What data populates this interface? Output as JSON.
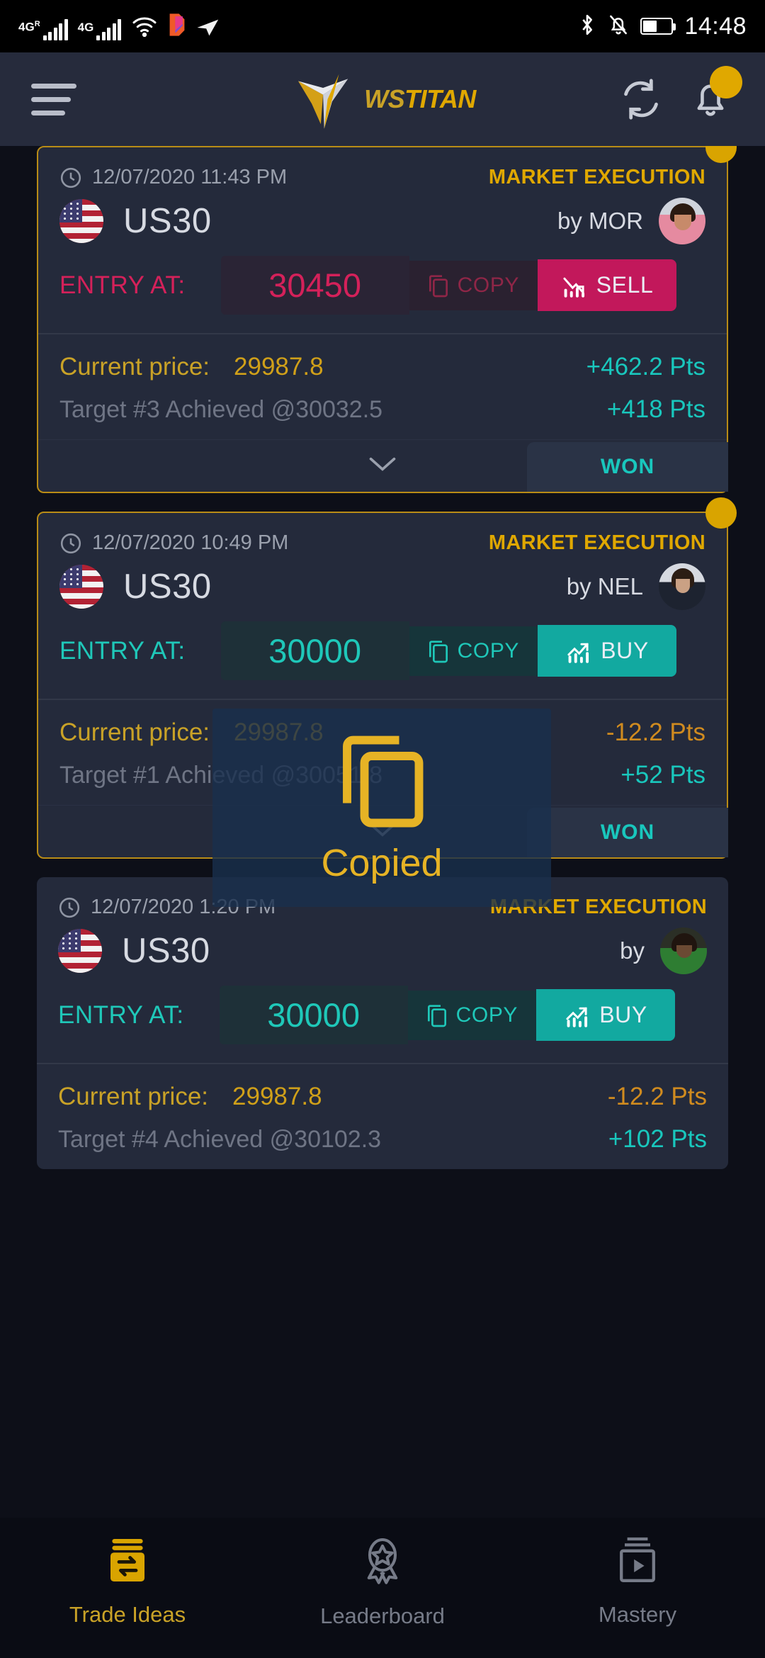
{
  "status_bar": {
    "network_1": "4G",
    "network_1_sup": "R",
    "network_2": "4G",
    "icons": [
      "wifi-icon",
      "app-icon",
      "vpn-icon",
      "bluetooth-icon",
      "silent-bell-icon",
      "battery-icon"
    ],
    "battery_percent": 50,
    "time": "14:48"
  },
  "header": {
    "menu": "menu-icon",
    "brand_ws": "WS",
    "brand_titan": "TITAN",
    "refresh": "refresh-icon",
    "notifications": "bell-icon"
  },
  "cards": [
    {
      "timestamp": "12/07/2020 11:43 PM",
      "execution": "MARKET EXECUTION",
      "symbol": "US30",
      "flag": "us-flag-icon",
      "author_prefix": "by",
      "author": "MOR",
      "entry_label": "ENTRY AT:",
      "entry_value": "30450",
      "copy_label": "COPY",
      "side_label": "SELL",
      "side": "sell",
      "price_label": "Current price:",
      "price_value": "29987.8",
      "price_points": "+462.2 Pts",
      "price_points_sign": "pos",
      "target_label": "Target #3 Achieved @30032.5",
      "target_points": "+418 Pts",
      "status": "WON",
      "has_badge": true
    },
    {
      "timestamp": "12/07/2020 10:49 PM",
      "execution": "MARKET EXECUTION",
      "symbol": "US30",
      "flag": "us-flag-icon",
      "author_prefix": "by",
      "author": "NEL",
      "entry_label": "ENTRY AT:",
      "entry_value": "30000",
      "copy_label": "COPY",
      "side_label": "BUY",
      "side": "buy",
      "price_label": "Current price:",
      "price_value": "29987.8",
      "price_points": "-12.2 Pts",
      "price_points_sign": "neg",
      "target_label": "Target #1 Achieved @30051.8",
      "target_points": "+52 Pts",
      "status": "WON",
      "has_badge": true
    },
    {
      "timestamp": "12/07/2020 1:20 PM",
      "execution": "MARKET EXECUTION",
      "symbol": "US30",
      "flag": "us-flag-icon",
      "author_prefix": "by",
      "author": "",
      "entry_label": "ENTRY AT:",
      "entry_value": "30000",
      "copy_label": "COPY",
      "side_label": "BUY",
      "side": "buy",
      "price_label": "Current price:",
      "price_value": "29987.8",
      "price_points": "-12.2 Pts",
      "price_points_sign": "neg",
      "target_label": "Target #4 Achieved @30102.3",
      "target_points": "+102 Pts",
      "status": "",
      "has_badge": false
    }
  ],
  "toast": {
    "icon": "copy-icon",
    "text": "Copied"
  },
  "bottom_nav": [
    {
      "label": "Trade Ideas",
      "icon": "trade-swap-icon",
      "active": true
    },
    {
      "label": "Leaderboard",
      "icon": "award-ribbon-icon",
      "active": false
    },
    {
      "label": "Mastery",
      "icon": "video-play-icon",
      "active": false
    }
  ],
  "colors": {
    "gold": "#e0a800",
    "teal": "#19c7bd",
    "crimson": "#c2185b",
    "card_bg": "#242a3b",
    "page_bg": "#0d0f18"
  }
}
